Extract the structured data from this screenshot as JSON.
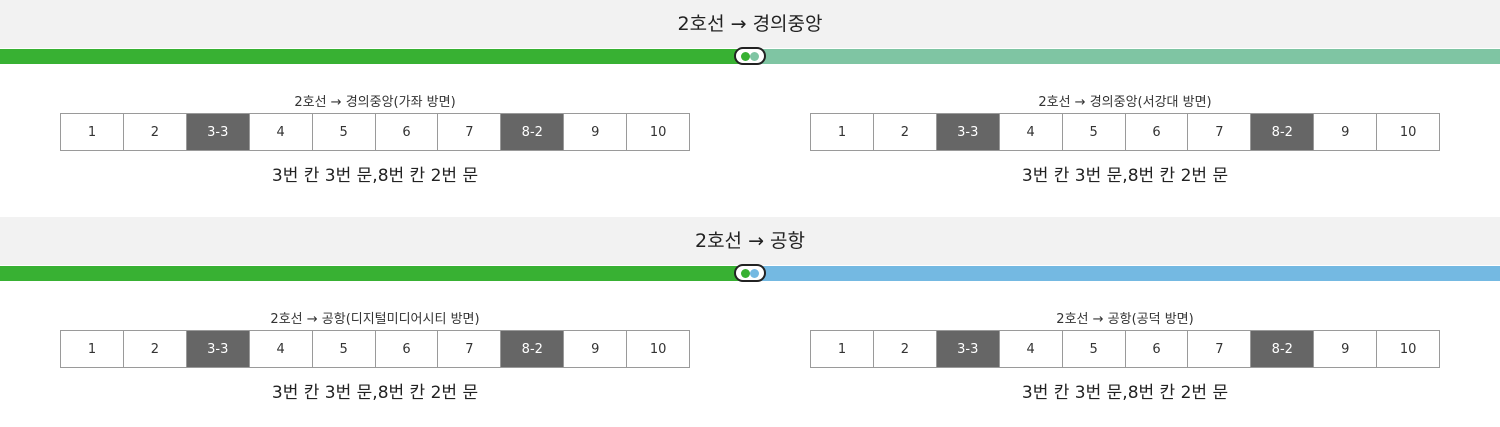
{
  "colors": {
    "line2": "#38b133",
    "gyeongui": "#7fc5a3",
    "airport": "#74b9e2",
    "highlight": "#666666"
  },
  "sections": [
    {
      "title": "2호선 → 경의중앙",
      "panels": [
        {
          "label": "2호선 → 경의중앙(가좌 방면)",
          "cars": [
            "1",
            "2",
            "3-3",
            "4",
            "5",
            "6",
            "7",
            "8-2",
            "9",
            "10"
          ],
          "highlighted": [
            "3-3",
            "8-2"
          ],
          "summary": "3번 칸 3번 문,8번 칸 2번 문"
        },
        {
          "label": "2호선 → 경의중앙(서강대 방면)",
          "cars": [
            "1",
            "2",
            "3-3",
            "4",
            "5",
            "6",
            "7",
            "8-2",
            "9",
            "10"
          ],
          "highlighted": [
            "3-3",
            "8-2"
          ],
          "summary": "3번 칸 3번 문,8번 칸 2번 문"
        }
      ]
    },
    {
      "title": "2호선 → 공항",
      "panels": [
        {
          "label": "2호선 → 공항(디지털미디어시티 방면)",
          "cars": [
            "1",
            "2",
            "3-3",
            "4",
            "5",
            "6",
            "7",
            "8-2",
            "9",
            "10"
          ],
          "highlighted": [
            "3-3",
            "8-2"
          ],
          "summary": "3번 칸 3번 문,8번 칸 2번 문"
        },
        {
          "label": "2호선 → 공항(공덕 방면)",
          "cars": [
            "1",
            "2",
            "3-3",
            "4",
            "5",
            "6",
            "7",
            "8-2",
            "9",
            "10"
          ],
          "highlighted": [
            "3-3",
            "8-2"
          ],
          "summary": "3번 칸 3번 문,8번 칸 2번 문"
        }
      ]
    }
  ]
}
